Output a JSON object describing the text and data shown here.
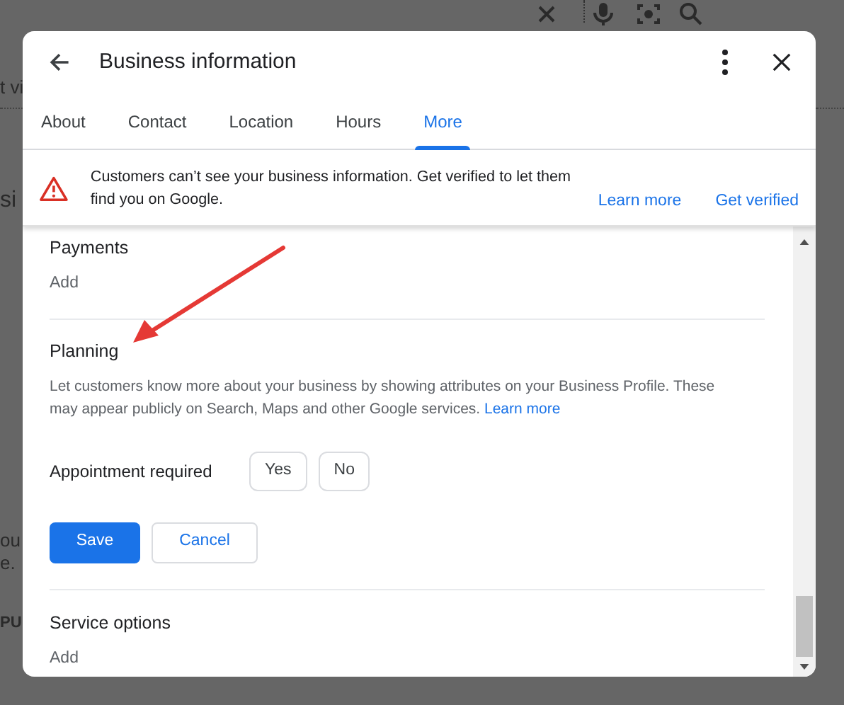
{
  "background_fragments": [
    "t vi",
    "si",
    "ou",
    "e.",
    "PU"
  ],
  "dialog": {
    "title": "Business information",
    "tabs": [
      {
        "label": "About",
        "selected": false
      },
      {
        "label": "Contact",
        "selected": false
      },
      {
        "label": "Location",
        "selected": false
      },
      {
        "label": "Hours",
        "selected": false
      },
      {
        "label": "More",
        "selected": true
      }
    ],
    "banner": {
      "message": "Customers can’t see your business information. Get verified to let them find you on Google.",
      "links": [
        "Learn more",
        "Get verified"
      ]
    },
    "sections": [
      {
        "kind": "add",
        "title": "Payments",
        "action": "Add"
      },
      {
        "kind": "form",
        "title": "Planning",
        "description": "Let customers know more about your business by showing attributes on your Business Profile. These may appear publicly on Search, Maps and other Google services.",
        "description_link": "Learn more",
        "attribute": {
          "label": "Appointment required",
          "options": [
            {
              "label": "Yes",
              "selected": false
            },
            {
              "label": "No",
              "selected": false
            }
          ]
        },
        "save": "Save",
        "cancel": "Cancel"
      },
      {
        "kind": "add",
        "title": "Service options",
        "action": "Add"
      }
    ]
  }
}
